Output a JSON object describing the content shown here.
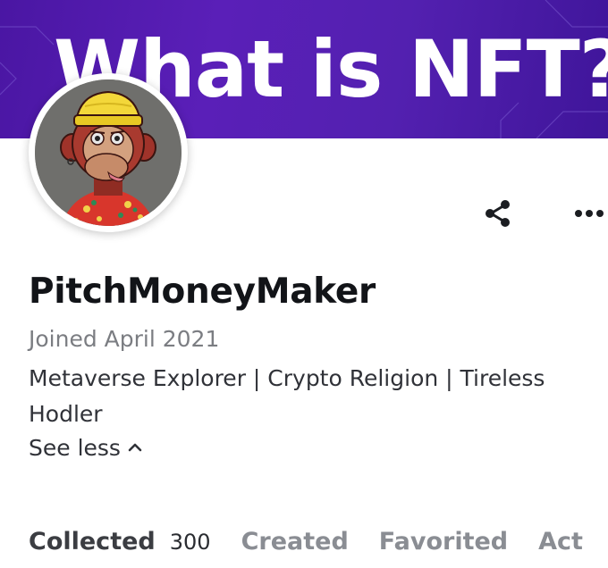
{
  "banner": {
    "title": "What is NFT?",
    "colors": {
      "start": "#4a16a3",
      "end": "#3f159a"
    }
  },
  "profile": {
    "avatar_icon": "bored-ape-avatar",
    "username": "PitchMoneyMaker",
    "joined": "Joined April 2021",
    "bio": "Metaverse Explorer | Crypto Religion | Tireless Hodler",
    "see_less": "See less"
  },
  "actions": {
    "share_icon": "share-icon",
    "more_icon": "more-dots-icon"
  },
  "tabs": [
    {
      "label": "Collected",
      "count": "300",
      "active": true
    },
    {
      "label": "Created",
      "active": false
    },
    {
      "label": "Favorited",
      "active": false
    },
    {
      "label": "Act",
      "active": false
    }
  ]
}
